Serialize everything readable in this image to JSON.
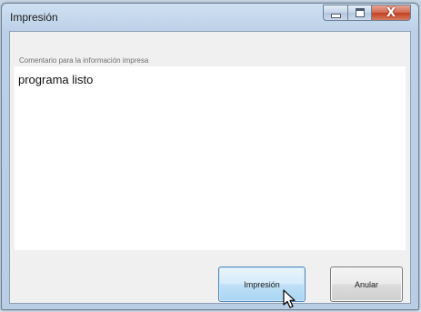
{
  "window": {
    "title": "Impresión"
  },
  "caption_buttons": {
    "minimize_icon": "minimize-icon",
    "maximize_icon": "maximize-icon",
    "close_icon": "close-icon",
    "close_glyph": "X"
  },
  "form": {
    "comment_label": "Comentario para la información impresa",
    "comment_value": "programa listo"
  },
  "buttons": {
    "print_label": "Impresión",
    "cancel_label": "Anular"
  },
  "colors": {
    "close_button": "#c3401f",
    "primary_button": "#a9d5f3"
  }
}
